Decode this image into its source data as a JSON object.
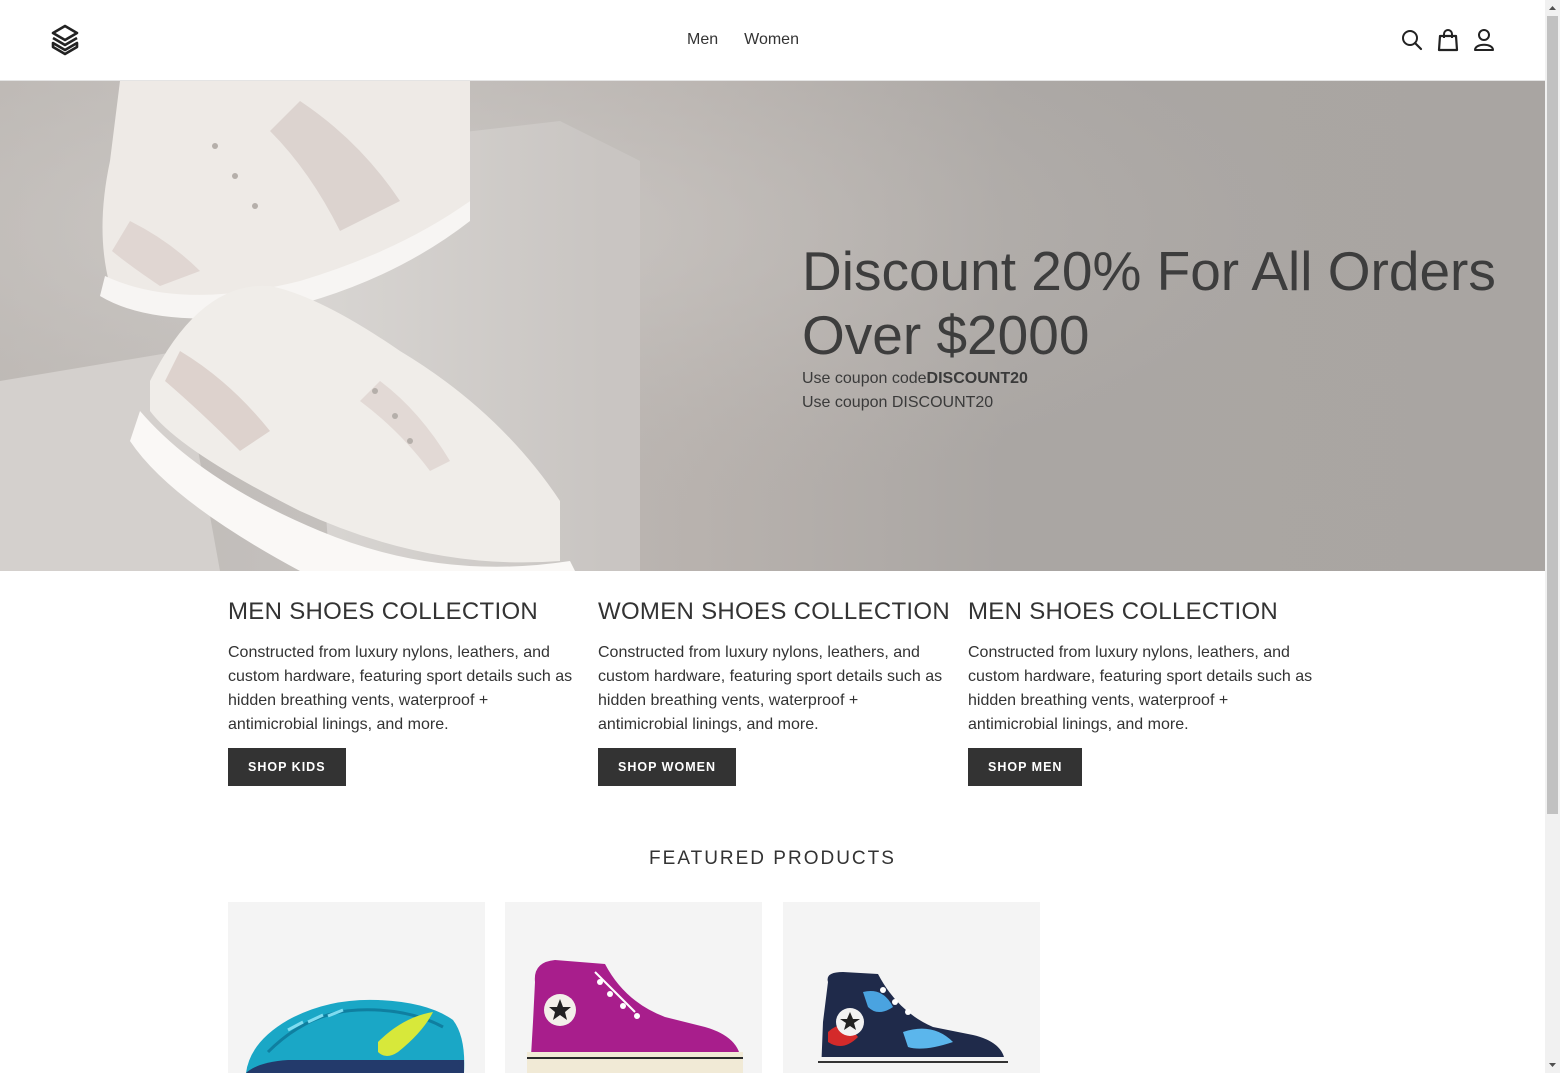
{
  "header": {
    "nav": [
      {
        "label": "Men"
      },
      {
        "label": "Women"
      }
    ],
    "icons": [
      "logo-icon",
      "search-icon",
      "bag-icon",
      "user-icon"
    ]
  },
  "hero": {
    "title": "Discount 20% For All Orders Over $2000",
    "line1_prefix": "Use coupon code",
    "line1_code": "DISCOUNT20",
    "line2": "Use coupon DISCOUNT20"
  },
  "collections": [
    {
      "title": "MEN SHOES COLLECTION",
      "text": "Constructed from luxury nylons, leathers, and custom hardware, featuring sport details such as hidden breathing vents, waterproof + antimicrobial linings, and more.",
      "button": "SHOP KIDS"
    },
    {
      "title": "WOMEN SHOES COLLECTION",
      "text": "Constructed from luxury nylons, leathers, and custom hardware, featuring sport details such as hidden breathing vents, waterproof + antimicrobial linings, and more.",
      "button": "SHOP WOMEN"
    },
    {
      "title": "MEN SHOES COLLECTION",
      "text": "Constructed from luxury nylons, leathers, and custom hardware, featuring sport details such as hidden breathing vents, waterproof + antimicrobial linings, and more.",
      "button": "SHOP MEN"
    }
  ],
  "featured": {
    "title": "FEATURED PRODUCTS",
    "products": [
      {
        "image": "teal-running-shoe"
      },
      {
        "image": "magenta-high-top-sneaker"
      },
      {
        "image": "navy-printed-high-top-sneaker"
      }
    ]
  },
  "colors": {
    "text": "#333333",
    "button_bg": "#333333",
    "hero_overlay": "#aaa6a3",
    "product_bg": "#f4f4f4"
  }
}
